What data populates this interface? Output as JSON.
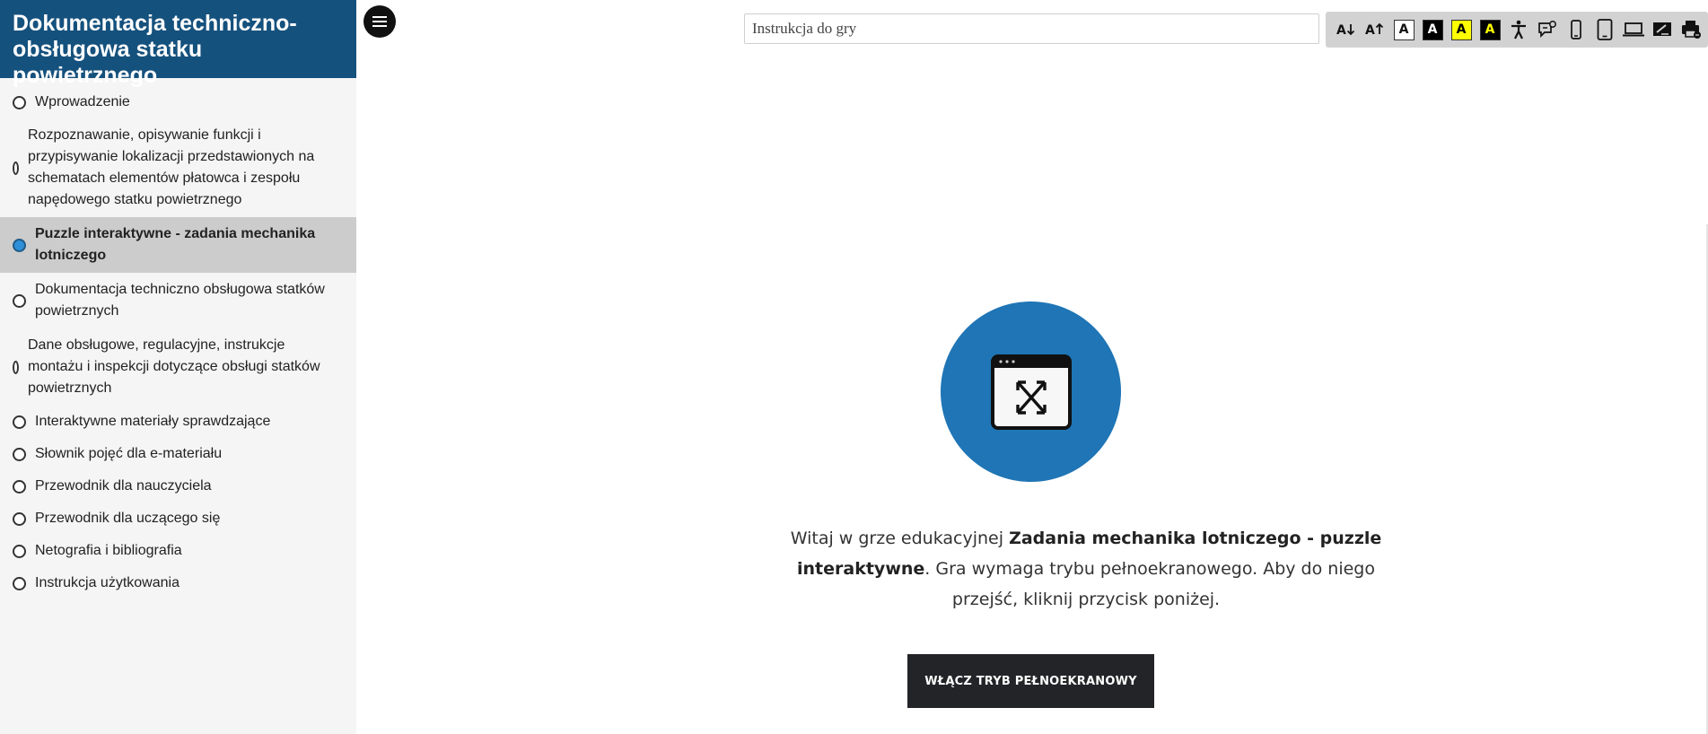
{
  "sidebar": {
    "title": "Dokumentacja techniczno-obsługowa statku powietrznego",
    "items": [
      {
        "label": "Wprowadzenie"
      },
      {
        "label": "Rozpoznawanie, opisywanie funkcji i przypisywanie lokalizacji przedstawionych na schematach elementów płatowca i zespołu napędowego statku powietrznego"
      },
      {
        "label": "Puzzle interaktywne - zadania mechanika lotniczego"
      },
      {
        "label": "Dokumentacja techniczno obsługowa statków powietrznych"
      },
      {
        "label": "Dane obsługowe, regulacyjne, instrukcje montażu i inspekcji dotyczące obsługi statków powietrznych"
      },
      {
        "label": "Interaktywne materiały sprawdzające"
      },
      {
        "label": "Słownik pojęć dla e-materiału"
      },
      {
        "label": "Przewodnik dla nauczyciela"
      },
      {
        "label": "Przewodnik dla uczącego się"
      },
      {
        "label": "Netografia i bibliografia"
      },
      {
        "label": "Instrukcja użytkowania"
      }
    ],
    "active_index": 2
  },
  "search": {
    "value": "Instrukcja do gry"
  },
  "toolbar": {
    "contrast_labels": [
      "A",
      "A",
      "A",
      "A"
    ],
    "icons": [
      "font-decrease-icon",
      "font-increase-icon",
      "contrast-default-icon",
      "contrast-black-white-icon",
      "contrast-yellow-black-icon",
      "contrast-black-yellow-icon",
      "accessibility-icon",
      "speech-bubble-icon",
      "mobile-view-icon",
      "tablet-view-icon",
      "desktop-view-icon",
      "sign-language-icon",
      "print-icon"
    ]
  },
  "main": {
    "welcome_prefix": "Witaj w grze edukacyjnej ",
    "welcome_bold": "Zadania mechanika lotniczego - puzzle interaktywne",
    "welcome_suffix": ". Gra wymaga trybu pełnoekranowego. Aby do niego przejść, kliknij przycisk poniżej.",
    "cta_label": "WŁĄCZ TRYB PEŁNOEKRANOWY"
  },
  "colors": {
    "header_bg": "#15517d",
    "hero_bg": "#1f75b5",
    "active_radio": "#2f8fd8",
    "cta_bg": "#232427"
  }
}
